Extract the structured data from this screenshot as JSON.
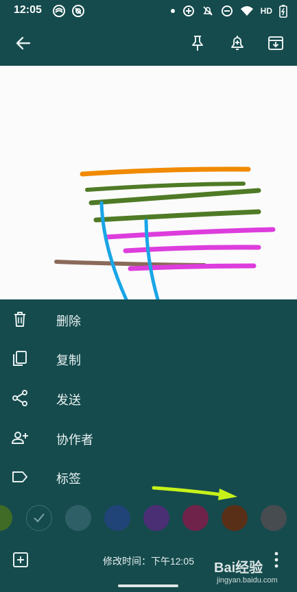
{
  "status_bar": {
    "time": "12:05",
    "network_label": "HD",
    "left_icons": [
      "sync-icon",
      "at-icon"
    ],
    "right_icons": [
      "dot-icon",
      "target-icon",
      "bell-off-icon",
      "minus-circle-icon",
      "wifi-icon",
      "hd",
      "battery-icon"
    ]
  },
  "toolbar": {
    "back_icon": "arrow-left-icon",
    "pin_icon": "pin-icon",
    "reminder_icon": "bell-plus-icon",
    "archive_icon": "archive-icon"
  },
  "drawing": {
    "background": "#fbfbfb",
    "stroke_colors": [
      "#f08a00",
      "#4f7a26",
      "#dd3ddd",
      "#8a6a5a",
      "#1aa5e6"
    ]
  },
  "menu": {
    "items": [
      {
        "label": "删除",
        "icon": "trash-icon"
      },
      {
        "label": "复制",
        "icon": "copy-icon"
      },
      {
        "label": "发送",
        "icon": "share-icon"
      },
      {
        "label": "协作者",
        "icon": "person-add-icon"
      },
      {
        "label": "标签",
        "icon": "label-icon"
      }
    ]
  },
  "color_swatches": [
    {
      "name": "green",
      "color": "#3f6b27"
    },
    {
      "name": "default",
      "color": "#154b4d",
      "selected": true
    },
    {
      "name": "teal",
      "color": "#2f5f66"
    },
    {
      "name": "blue",
      "color": "#214478"
    },
    {
      "name": "purple",
      "color": "#4b2f74"
    },
    {
      "name": "pink",
      "color": "#70234a"
    },
    {
      "name": "brown",
      "color": "#5a2f17"
    },
    {
      "name": "gray",
      "color": "#474c50"
    }
  ],
  "annotation_arrow_color": "#c6f21a",
  "footer": {
    "edited_text": "修改时间：下午12:05",
    "add_icon": "add-box-icon",
    "more_icon": "more-vert-icon"
  },
  "watermark": {
    "brand": "Bai经验",
    "domain": "jingyan.baidu.com"
  }
}
